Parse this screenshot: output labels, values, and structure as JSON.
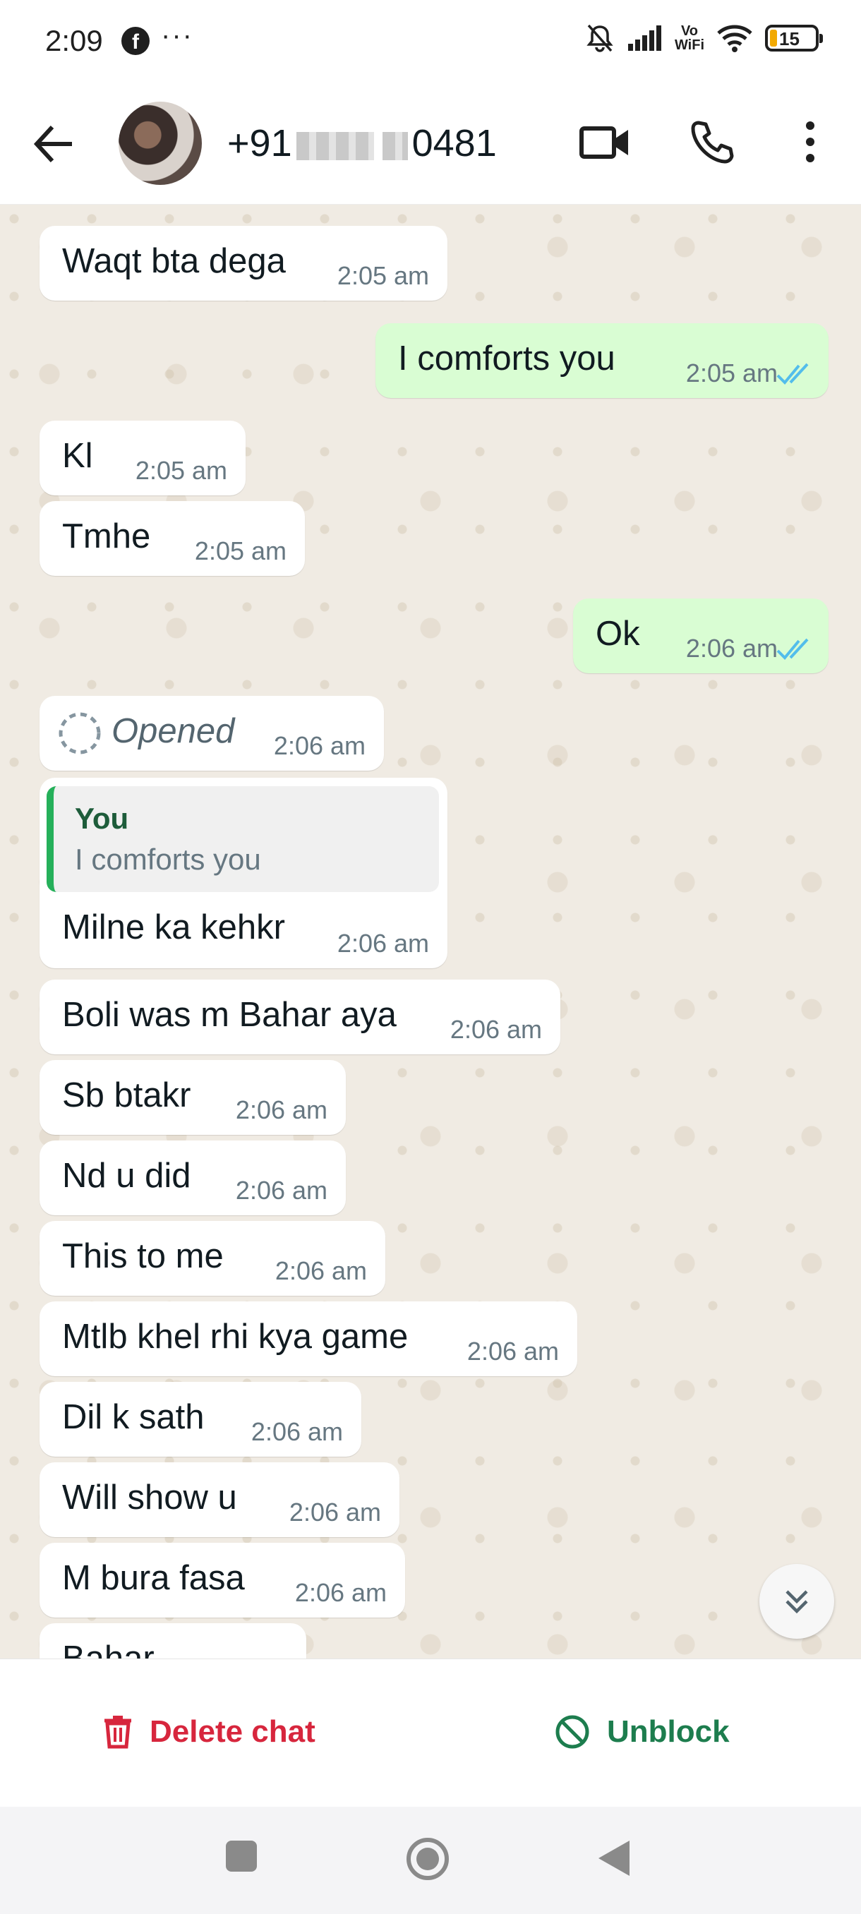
{
  "status_bar": {
    "time": "2:09",
    "fb_icon": "f",
    "more": "···",
    "vo": "Vo",
    "wifi_text": "WiFi",
    "battery": "15"
  },
  "header": {
    "contact_prefix": "+91",
    "contact_suffix": "0481"
  },
  "messages": [
    {
      "text": "Waqt bta dega",
      "time": "2:05 am"
    },
    {
      "text": "I comforts you",
      "time": "2:05 am"
    },
    {
      "text": "Kl",
      "time": "2:05 am"
    },
    {
      "text": "Tmhe",
      "time": "2:05 am"
    },
    {
      "text": "Ok",
      "time": "2:06 am"
    },
    {
      "text": "Opened",
      "time": "2:06 am"
    },
    {
      "quote_author": "You",
      "quote_text": "I comforts you",
      "text": "Milne ka kehkr",
      "time": "2:06 am"
    },
    {
      "text": "Boli was m Bahar aya",
      "time": "2:06 am"
    },
    {
      "text": "Sb btakr",
      "time": "2:06 am"
    },
    {
      "text": "Nd u did",
      "time": "2:06 am"
    },
    {
      "text": "This to me",
      "time": "2:06 am"
    },
    {
      "text": "Mtlb khel rhi kya game",
      "time": "2:06 am"
    },
    {
      "text": "Dil k sath",
      "time": "2:06 am"
    },
    {
      "text": "Will show u",
      "time": "2:06 am"
    },
    {
      "text": "M bura fasa",
      "time": "2:06 am"
    },
    {
      "text": "Bahar"
    }
  ],
  "actions": {
    "delete": "Delete chat",
    "unblock": "Unblock"
  },
  "colors": {
    "incoming": "#ffffff",
    "outgoing": "#d9fdd3",
    "delete": "#d7263d",
    "unblock": "#1d7d4e",
    "read_ticks": "#53bdeb"
  }
}
